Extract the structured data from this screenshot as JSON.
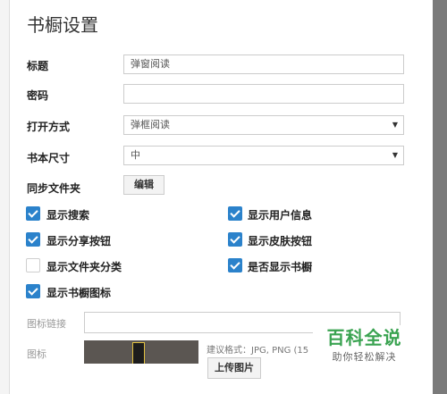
{
  "dialog": {
    "title": "书橱设置"
  },
  "form": {
    "title_label": "标题",
    "title_value": "弹窗阅读",
    "password_label": "密码",
    "password_value": "",
    "open_mode_label": "打开方式",
    "open_mode_value": "弹框阅读",
    "book_size_label": "书本尺寸",
    "book_size_value": "中",
    "sync_folder_label": "同步文件夹",
    "edit_button": "编辑"
  },
  "options": [
    {
      "label": "显示搜索",
      "checked": true
    },
    {
      "label": "显示用户信息",
      "checked": true
    },
    {
      "label": "显示分享按钮",
      "checked": true
    },
    {
      "label": "显示皮肤按钮",
      "checked": true
    },
    {
      "label": "显示文件夹分类",
      "checked": false
    },
    {
      "label": "是否显示书橱",
      "checked": true
    },
    {
      "label": "显示书橱图标",
      "checked": true
    }
  ],
  "icon_section": {
    "icon_link_label": "图标链接",
    "icon_link_value": "",
    "icon_label": "图标",
    "format_hint": "建议格式：JPG, PNG (15",
    "upload_button": "上传图片"
  },
  "watermark": {
    "main": "百科全说",
    "sub": "助你轻松解决"
  },
  "colors": {
    "checkbox_checked": "#2b82cb",
    "watermark_green": "#3aa351"
  }
}
